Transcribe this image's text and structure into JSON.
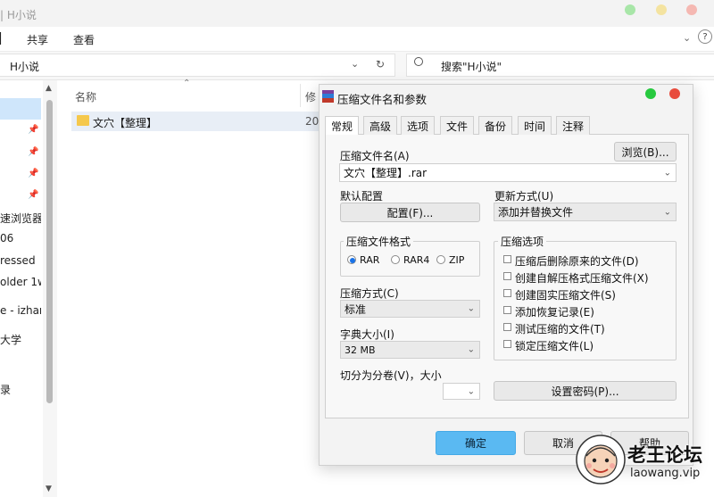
{
  "explorer": {
    "window_title": "| H小说",
    "menu": [
      "共享",
      "查看"
    ],
    "address": "H小说",
    "search_placeholder": "搜索\"H小说\"",
    "column_name": "名称",
    "column_modified_partial": "修",
    "file_row": {
      "name": "文穴【整理】",
      "date_partial": "20"
    },
    "nav_items": [
      "速浏览器\"",
      "06",
      "ressed",
      "older 1w",
      "e - izhan",
      "大学",
      "录"
    ]
  },
  "dialog": {
    "title": "压缩文件名和参数",
    "tabs": [
      "常规",
      "高级",
      "选项",
      "文件",
      "备份",
      "时间",
      "注释"
    ],
    "archive_name_label": "压缩文件名(A)",
    "browse_button": "浏览(B)...",
    "archive_name_value": "文穴【整理】.rar",
    "default_profile_label": "默认配置",
    "profile_button": "配置(F)...",
    "update_mode_label": "更新方式(U)",
    "update_mode_value": "添加并替换文件",
    "format_group": "压缩文件格式",
    "formats": [
      "RAR",
      "RAR4",
      "ZIP"
    ],
    "selected_format": "RAR",
    "options_group": "压缩选项",
    "options": [
      "压缩后删除原来的文件(D)",
      "创建自解压格式压缩文件(X)",
      "创建固实压缩文件(S)",
      "添加恢复记录(E)",
      "测试压缩的文件(T)",
      "锁定压缩文件(L)"
    ],
    "method_label": "压缩方式(C)",
    "method_value": "标准",
    "dict_label": "字典大小(I)",
    "dict_value": "32 MB",
    "split_label": "切分为分卷(V)，大小",
    "password_button": "设置密码(P)...",
    "ok_button": "确定",
    "cancel_button": "取消",
    "help_button": "帮助"
  },
  "watermark": {
    "title": "老王论坛",
    "url": "laowang.vip"
  },
  "colors": {
    "ok_blue": "#5ab9f2",
    "close_red": "#e84c3d",
    "max_green": "#27c93f"
  }
}
